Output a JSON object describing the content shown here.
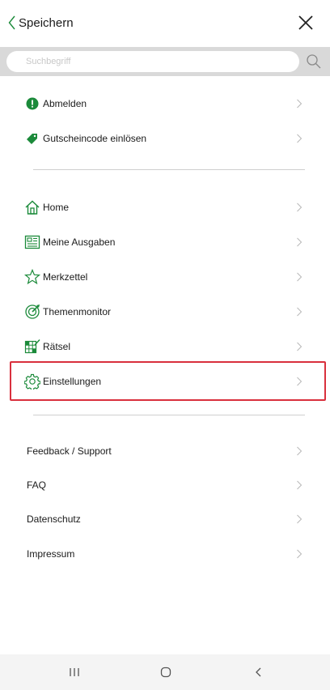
{
  "header": {
    "back_label": "Speichern",
    "back_icon": "chevron-left-icon",
    "close_icon": "close-icon"
  },
  "search": {
    "placeholder": "Suchbegriff",
    "icon": "search-icon"
  },
  "account_items": [
    {
      "label": "Abmelden",
      "icon": "logout-icon"
    },
    {
      "label": "Gutscheincode einlösen",
      "icon": "tag-icon"
    }
  ],
  "nav_items": [
    {
      "label": "Home",
      "icon": "home-icon"
    },
    {
      "label": "Meine Ausgaben",
      "icon": "newspaper-icon"
    },
    {
      "label": "Merkzettel",
      "icon": "star-icon"
    },
    {
      "label": "Themenmonitor",
      "icon": "target-icon"
    },
    {
      "label": "Rätsel",
      "icon": "puzzle-grid-icon"
    },
    {
      "label": "Einstellungen",
      "icon": "gear-icon"
    }
  ],
  "info_items": [
    {
      "label": "Feedback / Support"
    },
    {
      "label": "FAQ"
    },
    {
      "label": "Datenschutz"
    },
    {
      "label": "Impressum"
    }
  ],
  "system_nav": {
    "recents_icon": "recent-apps-icon",
    "home_icon": "home-button-icon",
    "back_icon": "back-icon"
  },
  "colors": {
    "accent_green": "#1b8a3a",
    "highlight_red": "#d9303d",
    "search_bar_bg": "#d9d9d9",
    "chevron_gray": "#b8b8b8"
  }
}
